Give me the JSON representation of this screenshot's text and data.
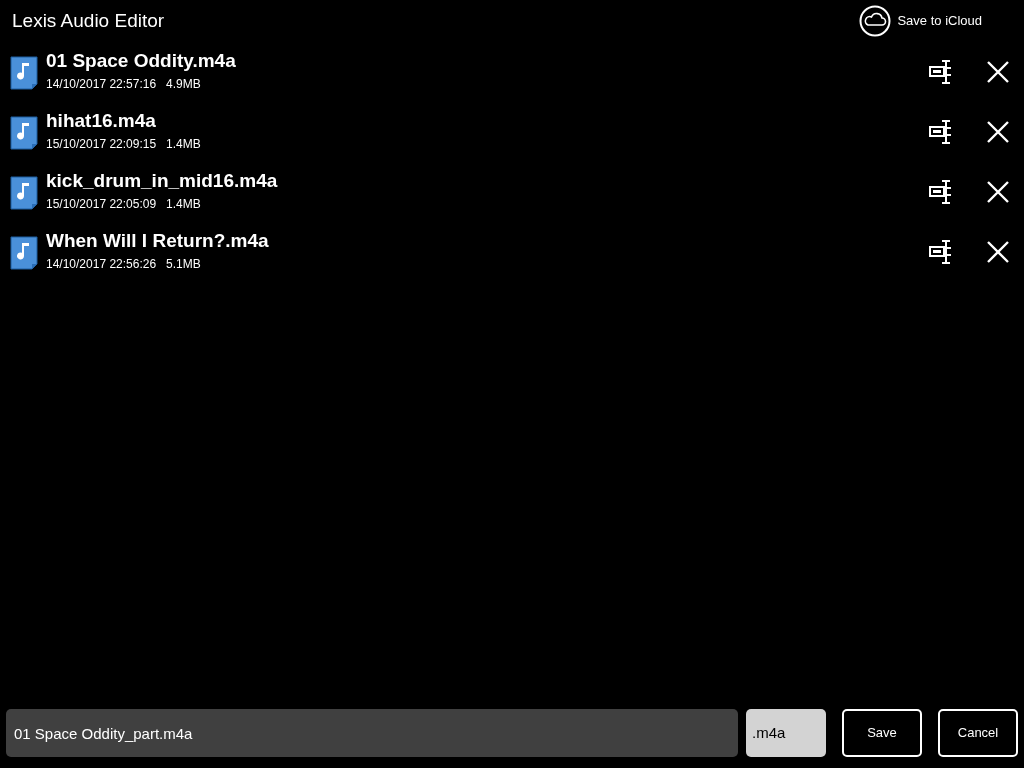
{
  "window": {
    "title": "Lexis Audio Editor"
  },
  "icloud_button": {
    "label": "Save to iCloud"
  },
  "files": [
    {
      "name": "01 Space Oddity.m4a",
      "date": "14/10/2017 22:57:16",
      "size": "4.9MB"
    },
    {
      "name": "hihat16.m4a",
      "date": "15/10/2017 22:09:15",
      "size": "1.4MB"
    },
    {
      "name": "kick_drum_in_mid16.m4a",
      "date": "15/10/2017 22:05:09",
      "size": "1.4MB"
    },
    {
      "name": "When Will I Return?.m4a",
      "date": "14/10/2017 22:56:26",
      "size": "5.1MB"
    }
  ],
  "filename_field": {
    "value": "01 Space Oddity_part.m4a"
  },
  "extension": ".m4a",
  "buttons": [
    "Save",
    "Cancel"
  ]
}
